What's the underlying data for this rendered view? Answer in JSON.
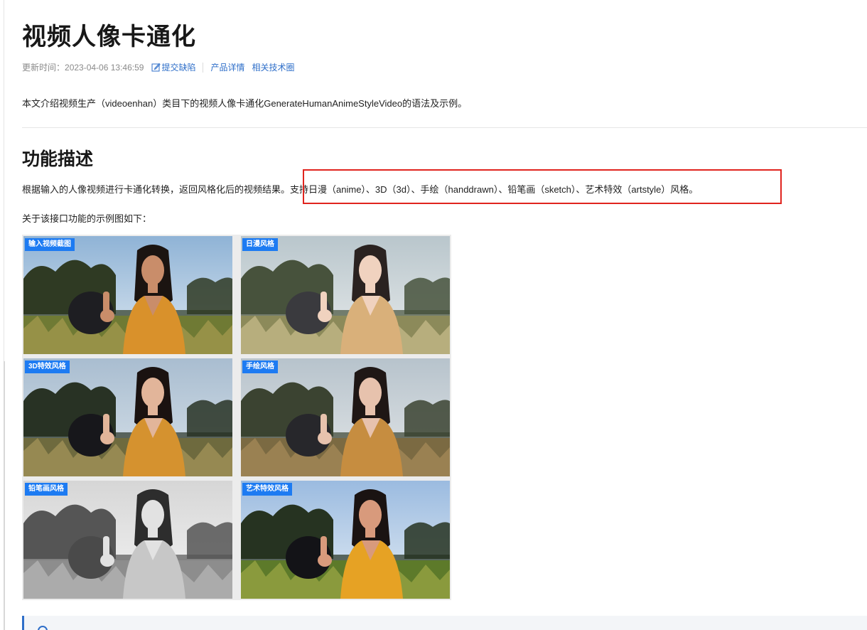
{
  "page": {
    "title": "视频人像卡通化",
    "updated_label": "更新时间：",
    "updated_time": "2023-04-06 13:46:59",
    "submit_bug": "提交缺陷",
    "product_detail": "产品详情",
    "tech_circle": "相关技术圈"
  },
  "intro": "本文介绍视频生产（videoenhan）类目下的视频人像卡通化GenerateHumanAnimeStyleVideo的语法及示例。",
  "section": {
    "heading": "功能描述",
    "desc_part1": "根据输入的人像视频进行卡通化转换，返回风格化后的视频结果。",
    "desc_part2": "支持日漫（anime）、3D（3d）、手绘（handdrawn）、铅笔画（sketch）、艺术特效（artstyle）风格。",
    "example_intro": "关于该接口功能的示例图如下："
  },
  "examples": [
    {
      "label": "输入视频截图",
      "style": "original"
    },
    {
      "label": "日漫风格",
      "style": "anime"
    },
    {
      "label": "3D特效风格",
      "style": "3d"
    },
    {
      "label": "手绘风格",
      "style": "handdrawn"
    },
    {
      "label": "铅笔画风格",
      "style": "sketch"
    },
    {
      "label": "艺术特效风格",
      "style": "artstyle"
    }
  ],
  "note": {
    "icon": "info-icon",
    "text": ""
  },
  "colors": {
    "link": "#2f6fc9",
    "tag": "#1d7bf2",
    "highlight": "#e0241e"
  }
}
